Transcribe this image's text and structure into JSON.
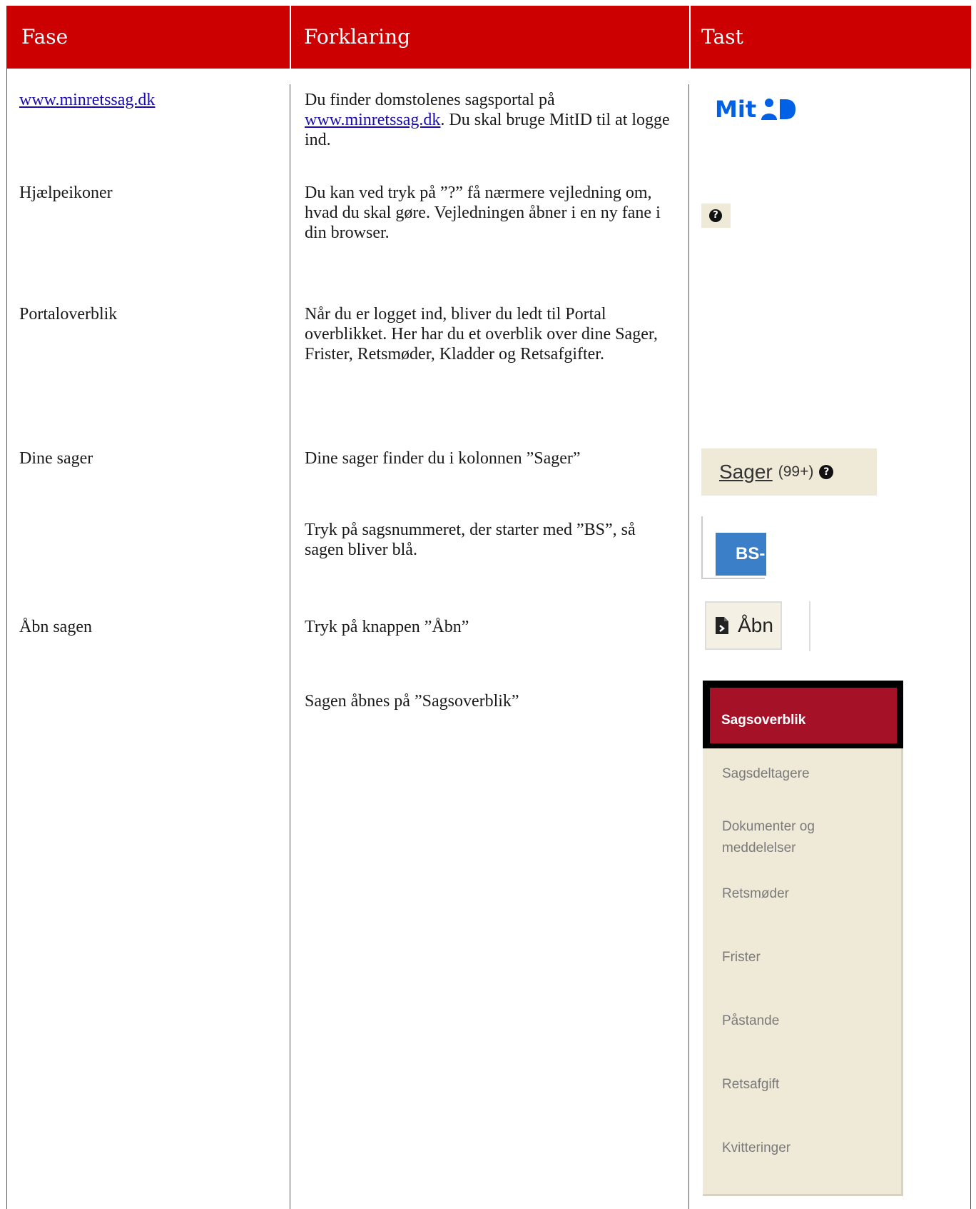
{
  "header": {
    "col_fase": "Fase",
    "col_forklaring": "Forklaring",
    "col_tast": "Tast",
    "bg_color": "#cc0000"
  },
  "rows": [
    {
      "fase": "www.minretssag.dk",
      "forklaring_part1": "Du finder domstolenes sagsportal på",
      "forklaring_link": "www.minretssag.dk",
      "forklaring_part2": ". Du skal bruge MitID til at logge ind."
    },
    {
      "fase": "Hjælpeikoner",
      "forklaring": "Du kan ved tryk på ”?” få nærmere vejledning om, hvad du skal gøre. Vejledningen åbner i en ny fane i din browser."
    },
    {
      "fase": "Portaloverblik",
      "forklaring": "Når du er logget ind, bliver du ledt til Portal overblikket. Her har du et overblik over dine Sager, Frister, Retsmøder, Kladder og Retsafgifter."
    },
    {
      "fase": "Dine sager",
      "forklaring": "Dine sager finder du i kolonnen ”Sager”"
    },
    {
      "fase": "",
      "forklaring": "Tryk på sagsnummeret, der starter med ”BS”, så sagen bliver blå."
    },
    {
      "fase": "Åbn sagen",
      "forklaring": "Tryk på knappen ”Åbn”"
    },
    {
      "fase": "",
      "forklaring": "Sagen åbnes på ”Sagsoverblik”"
    }
  ],
  "mitid_logo": {
    "text": "Mit",
    "color": "#0060e6"
  },
  "help_icon": {
    "glyph": "?",
    "icon": "question-circle-icon"
  },
  "sager_button": {
    "label": "Sager",
    "count": "(99+)",
    "help_glyph": "?"
  },
  "bs_button": {
    "label": "BS-"
  },
  "abn_button": {
    "label": "Åbn",
    "icon": "open-document-icon"
  },
  "nav_menu": {
    "active": "Sagsoverblik",
    "items": [
      "Sagsdeltagere",
      "Dokumenter og meddelelser",
      "Retsmøder",
      "Frister",
      "Påstande",
      "Retsafgift",
      "Kvitteringer"
    ],
    "active_color": "#a51228"
  }
}
